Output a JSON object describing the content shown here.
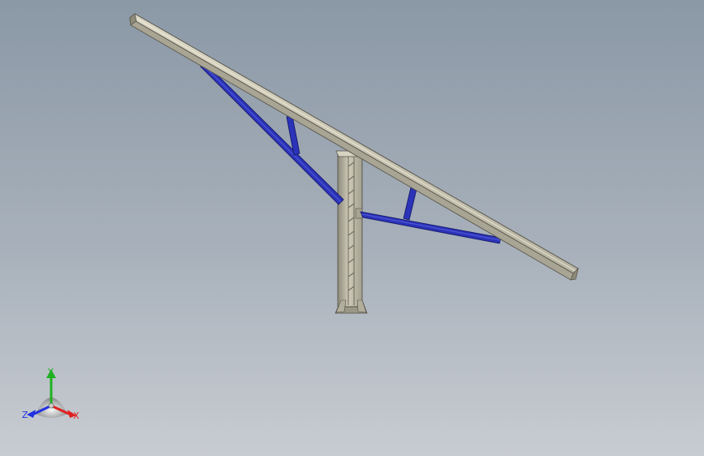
{
  "viewport": {
    "background_top": "#8b98a6",
    "background_bottom": "#c8ccd2"
  },
  "model": {
    "steel_color": "#c4c0ae",
    "brace_color": "#2b33b8",
    "components": [
      "top-beam",
      "support-column",
      "left-main-brace",
      "left-strut",
      "right-main-brace",
      "right-strut"
    ]
  },
  "triad": {
    "labels": {
      "x": "X",
      "y": "Y",
      "z": "Z"
    },
    "colors": {
      "x": "#e02020",
      "y": "#20b020",
      "z": "#2030e0"
    }
  }
}
